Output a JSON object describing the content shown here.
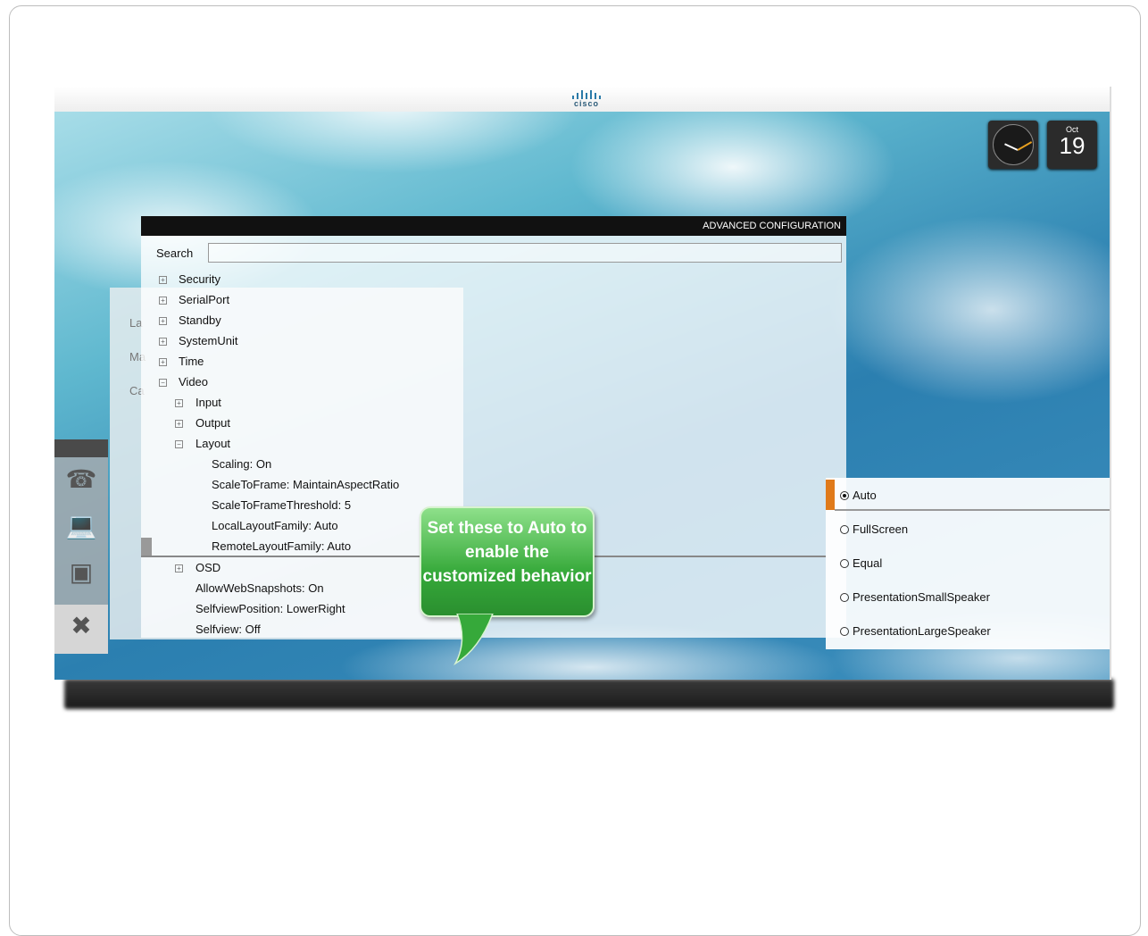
{
  "brand": {
    "logo_text": "cisco"
  },
  "calendar": {
    "month": "Oct",
    "day": "19"
  },
  "background_menu": {
    "items": [
      "La",
      "Ma",
      "Ca"
    ]
  },
  "dock": {
    "icons": [
      "phone-icon",
      "laptop-icon",
      "camera-icon",
      "tools-icon"
    ]
  },
  "advanced_config": {
    "title": "ADVANCED CONFIGURATION",
    "search_label": "Search",
    "search_value": "",
    "tree": {
      "security": "Security",
      "serialport": "SerialPort",
      "standby": "Standby",
      "systemunit": "SystemUnit",
      "time": "Time",
      "video": "Video",
      "input": "Input",
      "output": "Output",
      "layout": "Layout",
      "scaling": "Scaling: On",
      "scaletoframe": "ScaleToFrame: MaintainAspectRatio",
      "scaletoframethreshold": "ScaleToFrameThreshold: 5",
      "localfamily": "LocalLayoutFamily: Auto",
      "remotefamily": "RemoteLayoutFamily: Auto",
      "osd": "OSD",
      "allowweb": "AllowWebSnapshots: On",
      "selfviewpos": "SelfviewPosition: LowerRight",
      "selfview": "Selfview: Off"
    }
  },
  "callout": {
    "text": "Set these to Auto to enable the customized behavior"
  },
  "options": {
    "selected": "Auto",
    "items": [
      "Auto",
      "FullScreen",
      "Equal",
      "PresentationSmallSpeaker",
      "PresentationLargeSpeaker"
    ]
  },
  "colors": {
    "accent": "#e07a1a",
    "callout": "#36a93a",
    "header": "#111111"
  }
}
